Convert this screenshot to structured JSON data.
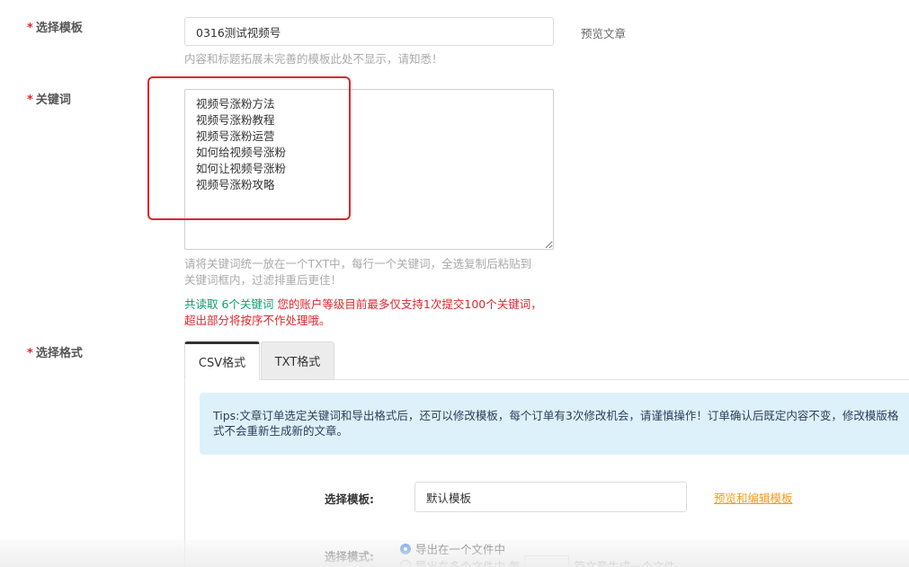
{
  "template_field": {
    "required_mark": "*",
    "label": "选择模板",
    "value": "0316测试视频号",
    "preview_link": "预览文章",
    "help": "内容和标题拓展未完善的模板此处不显示，请知悉！"
  },
  "keyword_field": {
    "required_mark": "*",
    "label": "关键词",
    "value": "视频号涨粉方法\n视频号涨粉教程\n视频号涨粉运营\n如何给视频号涨粉\n如何让视频号涨粉\n视频号涨粉攻略",
    "help_line1": "请将关键词统一放在一个TXT中，每行一个关键词，全选复制后粘贴到",
    "help_line2": "关键词框内，过滤排重后更佳！",
    "count_text": "共读取 6个关键词",
    "limit_text": " 您的账户等级目前最多仅支持1次提交100个关键词，超出部分将按序不作处理哦。"
  },
  "format_field": {
    "required_mark": "*",
    "label": "选择格式",
    "tabs": [
      {
        "label": "CSV格式",
        "active": true
      },
      {
        "label": "TXT格式",
        "active": false
      }
    ],
    "tips": "Tips:文章订单选定关键词和导出格式后，还可以修改模板，每个订单有3次修改机会，请谨慎操作！订单确认后既定内容不变，修改模版格式不会重新生成新的文章。",
    "template_row_label": "选择模板:",
    "template_value": "默认模板",
    "template_link": "预览和编辑模板",
    "mode_row_label": "选择模式:",
    "mode_options": [
      {
        "label": "导出在一个文件中",
        "checked": true
      },
      {
        "label_before": "导出在多个文件中 每",
        "label_after": "篇文章生成一个文件",
        "checked": false
      }
    ]
  },
  "colors": {
    "required": "#e0262c",
    "count_green": "#0aa06e",
    "warning_red": "#e0262c",
    "link_orange": "#f39c1b",
    "tips_bg": "#ddf1fb",
    "highlight_box": "#e0262c"
  }
}
